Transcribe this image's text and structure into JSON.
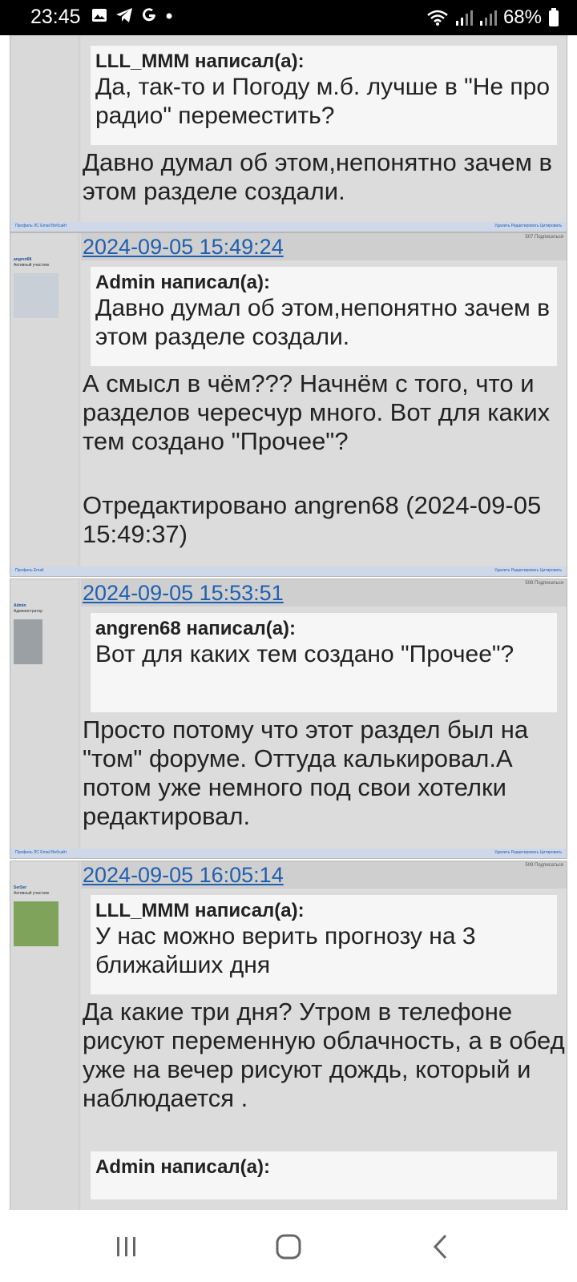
{
  "status_bar": {
    "time": "23:45",
    "battery": "68%"
  },
  "posts": [
    {
      "date": "",
      "quote_author": "LLL_MMM написал(а):",
      "quote_text": "Да, так-то и Погоду м.б. лучше в \"Не про радио\" переместить?",
      "text": "Давно думал об этом,непонятно зачем в этом разделе создали.",
      "footer_left": "Профиль  ЛС  Email  Вебсайт",
      "footer_right": "Удалить  Редактировать  Цитировать"
    },
    {
      "date": "2024-09-05 15:49:24",
      "num": "507 Подписаться",
      "user": "angren68",
      "role": "Активный участник",
      "quote_author": "Admin написал(а):",
      "quote_text": "Давно думал об этом,непонятно зачем в этом разделе создали.",
      "text": "А смысл в чём??? Начнём с того, что и разделов чересчур много. Вот для каких тем создано \"Прочее\"?",
      "edit_note": "Отредактировано angren68 (2024-09-05 15:49:37)",
      "footer_left": "Профиль  Email",
      "footer_right": "Удалить  Редактировать  Цитировать"
    },
    {
      "date": "2024-09-05 15:53:51",
      "num": "508 Подписаться",
      "user": "Admin",
      "role": "Администратор",
      "quote_author": "angren68 написал(а):",
      "quote_text": "Вот для каких тем создано \"Прочее\"?",
      "text": "Просто потому что этот раздел был на \"том\" форуме. Оттуда калькировал.А потом уже немного под свои хотелки редактировал.",
      "footer_left": "Профиль  ЛС  Email  Вебсайт",
      "footer_right": "Удалить  Редактировать  Цитировать"
    },
    {
      "date": "2024-09-05 16:05:14",
      "num": "509 Подписаться",
      "user": "SerSer",
      "role": "Активный участник",
      "quote_author": "LLL_MMM написал(а):",
      "quote_text": "У нас можно верить прогнозу на 3 ближайших дня",
      "text": "Да какие три дня? Утром в телефоне рисуют переменную облачность, а в обед уже на вечер рисуют дождь, который и наблюдается .",
      "quote2_author": "Admin написал(а):"
    }
  ],
  "colors": {
    "link": "#1f5fb0",
    "post_bg": "#dcdcdc",
    "quote_bg": "#f6f6f6"
  }
}
